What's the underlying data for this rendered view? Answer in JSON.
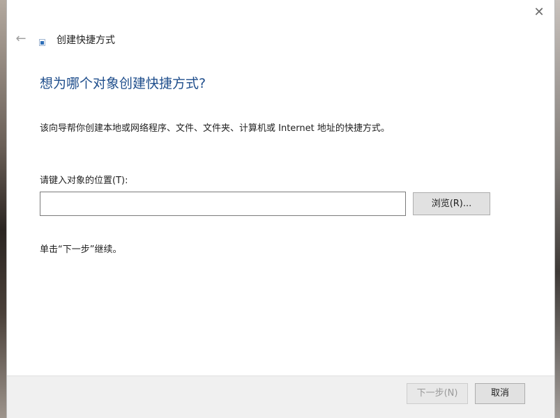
{
  "window": {
    "title": "创建快捷方式",
    "close_label": "✕",
    "back_label": "←"
  },
  "main": {
    "heading": "想为哪个对象创建快捷方式?",
    "description": "该向导帮你创建本地或网络程序、文件、文件夹、计算机或 Internet 地址的快捷方式。",
    "location_label": "请键入对象的位置(T):",
    "location_value": "",
    "browse_label": "浏览(R)...",
    "hint": "单击“下一步”继续。"
  },
  "footer": {
    "next_label": "下一步(N)",
    "cancel_label": "取消"
  },
  "colors": {
    "heading": "#1f4e8c",
    "footer_bg": "#f0f0f0"
  }
}
